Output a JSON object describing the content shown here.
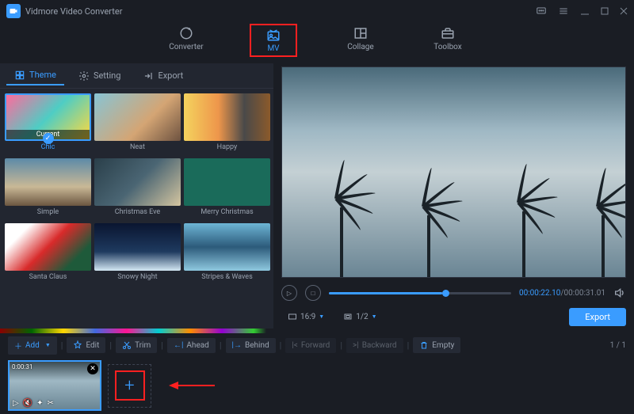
{
  "app": {
    "title": "Vidmore Video Converter"
  },
  "maintabs": {
    "converter": "Converter",
    "mv": "MV",
    "collage": "Collage",
    "toolbox": "Toolbox"
  },
  "subtabs": {
    "theme": "Theme",
    "setting": "Setting",
    "export": "Export"
  },
  "themes": {
    "current_badge": "Current",
    "chic": "Chic",
    "neat": "Neat",
    "happy": "Happy",
    "simple": "Simple",
    "xmas_eve": "Christmas Eve",
    "merry": "Merry Christmas",
    "santa": "Santa Claus",
    "snowy": "Snowy Night",
    "stripes": "Stripes & Waves"
  },
  "player": {
    "current_time": "00:00:22.10",
    "duration": "00:00:31.01",
    "aspect_ratio": "16:9",
    "zoom": "1/2"
  },
  "export_button": "Export",
  "toolbar": {
    "add": "Add",
    "edit": "Edit",
    "trim": "Trim",
    "ahead": "Ahead",
    "behind": "Behind",
    "forward": "Forward",
    "backward": "Backward",
    "empty": "Empty"
  },
  "pages": "1 / 1",
  "clip": {
    "duration": "0:00:31"
  }
}
